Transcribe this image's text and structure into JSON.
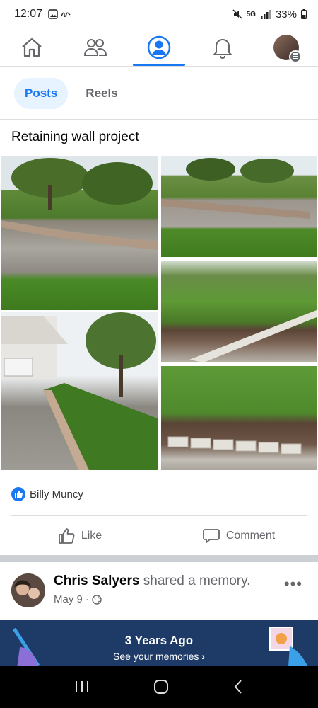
{
  "status_bar": {
    "time": "12:07",
    "network": "5G",
    "battery": "33%"
  },
  "nav": {
    "tabs": [
      {
        "icon": "home-icon"
      },
      {
        "icon": "friends-icon"
      },
      {
        "icon": "profile-icon",
        "active": true
      },
      {
        "icon": "bell-icon"
      },
      {
        "icon": "menu-avatar-icon"
      }
    ]
  },
  "subtabs": {
    "posts": "Posts",
    "reels": "Reels"
  },
  "post": {
    "title": "Retaining wall project",
    "reactor": "Billy Muncy",
    "like_label": "Like",
    "comment_label": "Comment"
  },
  "memory": {
    "name": "Chris Salyers",
    "action": " shared a memory.",
    "date": "May 9",
    "banner_title": "3 Years Ago",
    "banner_subtitle": "See your memories",
    "more": "•••"
  },
  "colors": {
    "accent": "#1877f2",
    "banner": "#1e3a66"
  }
}
